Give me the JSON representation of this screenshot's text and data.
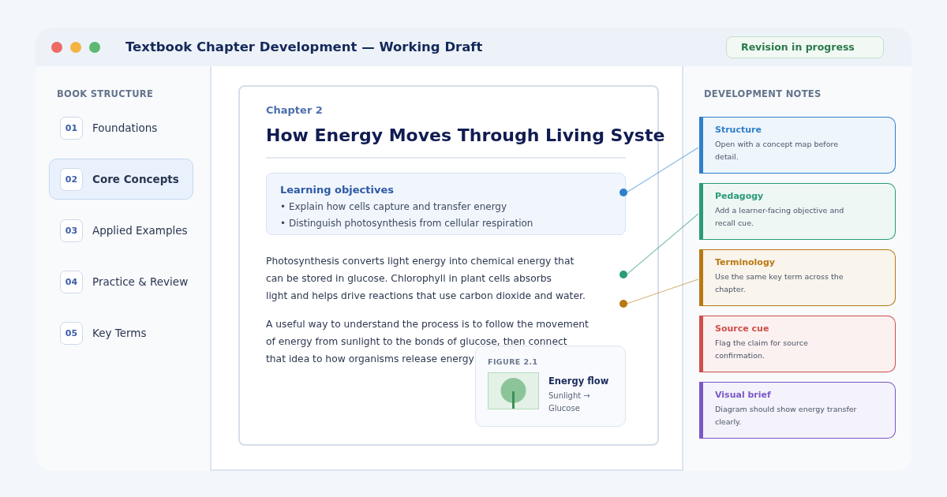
{
  "window": {
    "title": "Textbook Chapter Development — Working Draft",
    "status": "Revision in progress"
  },
  "sidebar": {
    "heading": "BOOK STRUCTURE",
    "items": [
      {
        "number": "01",
        "label": "Foundations",
        "selected": false
      },
      {
        "number": "02",
        "label": "Core Concepts",
        "selected": true
      },
      {
        "number": "03",
        "label": "Applied Examples",
        "selected": false
      },
      {
        "number": "04",
        "label": "Practice & Review",
        "selected": false
      },
      {
        "number": "05",
        "label": "Key Terms",
        "selected": false
      }
    ]
  },
  "chapter": {
    "eyebrow": "Chapter 2",
    "title": "How Energy Moves Through Living Syste",
    "objectives": {
      "heading": "Learning objectives",
      "items": [
        "• Explain how cells capture and transfer energy",
        "• Distinguish photosynthesis from cellular respiration"
      ]
    },
    "paragraphs": [
      [
        "Photosynthesis converts light energy into chemical energy that",
        "can be stored in glucose. Chlorophyll in plant cells absorbs",
        "light and helps drive reactions that use carbon dioxide and water."
      ],
      [
        "A useful way to understand the process is to follow the movement",
        "of energy from sunlight to the bonds of glucose, then connect",
        "that idea to how organisms release energy"
      ]
    ],
    "figure": {
      "label": "FIGURE 2.1",
      "kind": "picture",
      "title": "Energy flow",
      "caption": "Sunlight → Glucose"
    }
  },
  "notes": {
    "heading": "DEVELOPMENT NOTES",
    "items": [
      {
        "title": "Structure",
        "text": "Open with a concept map before detail.",
        "color": "#2f80cc",
        "linked": true
      },
      {
        "title": "Pedagogy",
        "text": "Add a learner-facing objective and recall cue.",
        "color": "#2a9a78",
        "linked": true
      },
      {
        "title": "Terminology",
        "text": "Use the same key term across the chapter.",
        "color": "#b87912",
        "linked": true
      },
      {
        "title": "Source cue",
        "text": "Flag the claim for source confirmation.",
        "color": "#cf4f49",
        "linked": false
      },
      {
        "title": "Visual brief",
        "text": "Diagram should show energy transfer clearly.",
        "color": "#7a58c6",
        "linked": false
      }
    ]
  }
}
